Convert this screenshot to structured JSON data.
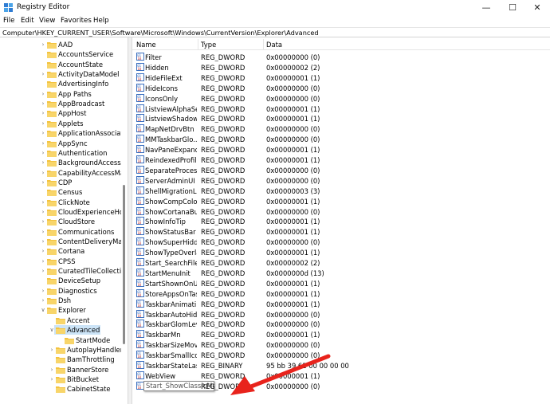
{
  "window": {
    "title": "Registry Editor",
    "minimize": "—",
    "maximize": "☐",
    "close": "✕"
  },
  "menu": [
    "File",
    "Edit",
    "View",
    "Favorites",
    "Help"
  ],
  "address": "Computer\\HKEY_CURRENT_USER\\Software\\Microsoft\\Windows\\CurrentVersion\\Explorer\\Advanced",
  "tree": [
    {
      "label": "AAD",
      "level": 0,
      "state": "collapsed"
    },
    {
      "label": "AccountsService",
      "level": 0,
      "state": "none"
    },
    {
      "label": "AccountState",
      "level": 0,
      "state": "none"
    },
    {
      "label": "ActivityDataModel",
      "level": 0,
      "state": "collapsed"
    },
    {
      "label": "AdvertisingInfo",
      "level": 0,
      "state": "none"
    },
    {
      "label": "App Paths",
      "level": 0,
      "state": "collapsed"
    },
    {
      "label": "AppBroadcast",
      "level": 0,
      "state": "collapsed"
    },
    {
      "label": "AppHost",
      "level": 0,
      "state": "collapsed"
    },
    {
      "label": "Applets",
      "level": 0,
      "state": "collapsed"
    },
    {
      "label": "ApplicationAssociatio",
      "level": 0,
      "state": "collapsed"
    },
    {
      "label": "AppSync",
      "level": 0,
      "state": "collapsed"
    },
    {
      "label": "Authentication",
      "level": 0,
      "state": "collapsed"
    },
    {
      "label": "BackgroundAccessAp",
      "level": 0,
      "state": "collapsed"
    },
    {
      "label": "CapabilityAccessMan",
      "level": 0,
      "state": "collapsed"
    },
    {
      "label": "CDP",
      "level": 0,
      "state": "collapsed"
    },
    {
      "label": "Census",
      "level": 0,
      "state": "none"
    },
    {
      "label": "ClickNote",
      "level": 0,
      "state": "collapsed"
    },
    {
      "label": "CloudExperienceHost",
      "level": 0,
      "state": "collapsed"
    },
    {
      "label": "CloudStore",
      "level": 0,
      "state": "collapsed"
    },
    {
      "label": "Communications",
      "level": 0,
      "state": "collapsed"
    },
    {
      "label": "ContentDeliveryMana",
      "level": 0,
      "state": "collapsed"
    },
    {
      "label": "Cortana",
      "level": 0,
      "state": "collapsed"
    },
    {
      "label": "CPSS",
      "level": 0,
      "state": "collapsed"
    },
    {
      "label": "CuratedTileCollection",
      "level": 0,
      "state": "collapsed"
    },
    {
      "label": "DeviceSetup",
      "level": 0,
      "state": "none"
    },
    {
      "label": "Diagnostics",
      "level": 0,
      "state": "collapsed"
    },
    {
      "label": "Dsh",
      "level": 0,
      "state": "collapsed"
    },
    {
      "label": "Explorer",
      "level": 0,
      "state": "expanded"
    },
    {
      "label": "Accent",
      "level": 1,
      "state": "none"
    },
    {
      "label": "Advanced",
      "level": 1,
      "state": "expanded",
      "selected": true
    },
    {
      "label": "StartMode",
      "level": 2,
      "state": "none"
    },
    {
      "label": "AutoplayHandlers",
      "level": 1,
      "state": "collapsed"
    },
    {
      "label": "BamThrottling",
      "level": 1,
      "state": "none"
    },
    {
      "label": "BannerStore",
      "level": 1,
      "state": "collapsed"
    },
    {
      "label": "BitBucket",
      "level": 1,
      "state": "collapsed"
    },
    {
      "label": "CabinetState",
      "level": 1,
      "state": "none"
    }
  ],
  "columns": {
    "name": "Name",
    "type": "Type",
    "data": "Data"
  },
  "values": [
    {
      "name": "Filter",
      "type": "REG_DWORD",
      "data": "0x00000000 (0)"
    },
    {
      "name": "Hidden",
      "type": "REG_DWORD",
      "data": "0x00000002 (2)"
    },
    {
      "name": "HideFileExt",
      "type": "REG_DWORD",
      "data": "0x00000001 (1)"
    },
    {
      "name": "HideIcons",
      "type": "REG_DWORD",
      "data": "0x00000000 (0)"
    },
    {
      "name": "IconsOnly",
      "type": "REG_DWORD",
      "data": "0x00000000 (0)"
    },
    {
      "name": "ListviewAlphaSe...",
      "type": "REG_DWORD",
      "data": "0x00000001 (1)"
    },
    {
      "name": "ListviewShadow",
      "type": "REG_DWORD",
      "data": "0x00000001 (1)"
    },
    {
      "name": "MapNetDrvBtn",
      "type": "REG_DWORD",
      "data": "0x00000000 (0)"
    },
    {
      "name": "MMTaskbarGlo...",
      "type": "REG_DWORD",
      "data": "0x00000000 (0)"
    },
    {
      "name": "NavPaneExpand...",
      "type": "REG_DWORD",
      "data": "0x00000001 (1)"
    },
    {
      "name": "ReindexedProfile",
      "type": "REG_DWORD",
      "data": "0x00000001 (1)"
    },
    {
      "name": "SeparateProcess",
      "type": "REG_DWORD",
      "data": "0x00000000 (0)"
    },
    {
      "name": "ServerAdminUI",
      "type": "REG_DWORD",
      "data": "0x00000000 (0)"
    },
    {
      "name": "ShellMigrationL...",
      "type": "REG_DWORD",
      "data": "0x00000003 (3)"
    },
    {
      "name": "ShowCompColor",
      "type": "REG_DWORD",
      "data": "0x00000001 (1)"
    },
    {
      "name": "ShowCortanaBu...",
      "type": "REG_DWORD",
      "data": "0x00000000 (0)"
    },
    {
      "name": "ShowInfoTip",
      "type": "REG_DWORD",
      "data": "0x00000001 (1)"
    },
    {
      "name": "ShowStatusBar",
      "type": "REG_DWORD",
      "data": "0x00000001 (1)"
    },
    {
      "name": "ShowSuperHidd...",
      "type": "REG_DWORD",
      "data": "0x00000000 (0)"
    },
    {
      "name": "ShowTypeOverlay",
      "type": "REG_DWORD",
      "data": "0x00000001 (1)"
    },
    {
      "name": "Start_SearchFiles",
      "type": "REG_DWORD",
      "data": "0x00000002 (2)"
    },
    {
      "name": "StartMenuInit",
      "type": "REG_DWORD",
      "data": "0x0000000d (13)"
    },
    {
      "name": "StartShownOnU...",
      "type": "REG_DWORD",
      "data": "0x00000001 (1)"
    },
    {
      "name": "StoreAppsOnTas...",
      "type": "REG_DWORD",
      "data": "0x00000001 (1)"
    },
    {
      "name": "TaskbarAnimati...",
      "type": "REG_DWORD",
      "data": "0x00000001 (1)"
    },
    {
      "name": "TaskbarAutoHid...",
      "type": "REG_DWORD",
      "data": "0x00000000 (0)"
    },
    {
      "name": "TaskbarGlomLevel",
      "type": "REG_DWORD",
      "data": "0x00000000 (0)"
    },
    {
      "name": "TaskbarMn",
      "type": "REG_DWORD",
      "data": "0x00000001 (1)"
    },
    {
      "name": "TaskbarSizeMove",
      "type": "REG_DWORD",
      "data": "0x00000000 (0)"
    },
    {
      "name": "TaskbarSmallIcons",
      "type": "REG_DWORD",
      "data": "0x00000000 (0)"
    },
    {
      "name": "TaskbarStateLast...",
      "type": "REG_BINARY",
      "data": "95 bb 39 62 00 00 00 00"
    },
    {
      "name": "WebView",
      "type": "REG_DWORD",
      "data": "0x00000001 (1)"
    }
  ],
  "new_value": {
    "name": "Start_ShowClassicMode",
    "type": "REG_DWORD",
    "data": "0x00000000 (0)"
  },
  "colors": {
    "accent_arrow": "#e8231c",
    "selection": "#cce4f7",
    "folder": "#f3c340"
  }
}
